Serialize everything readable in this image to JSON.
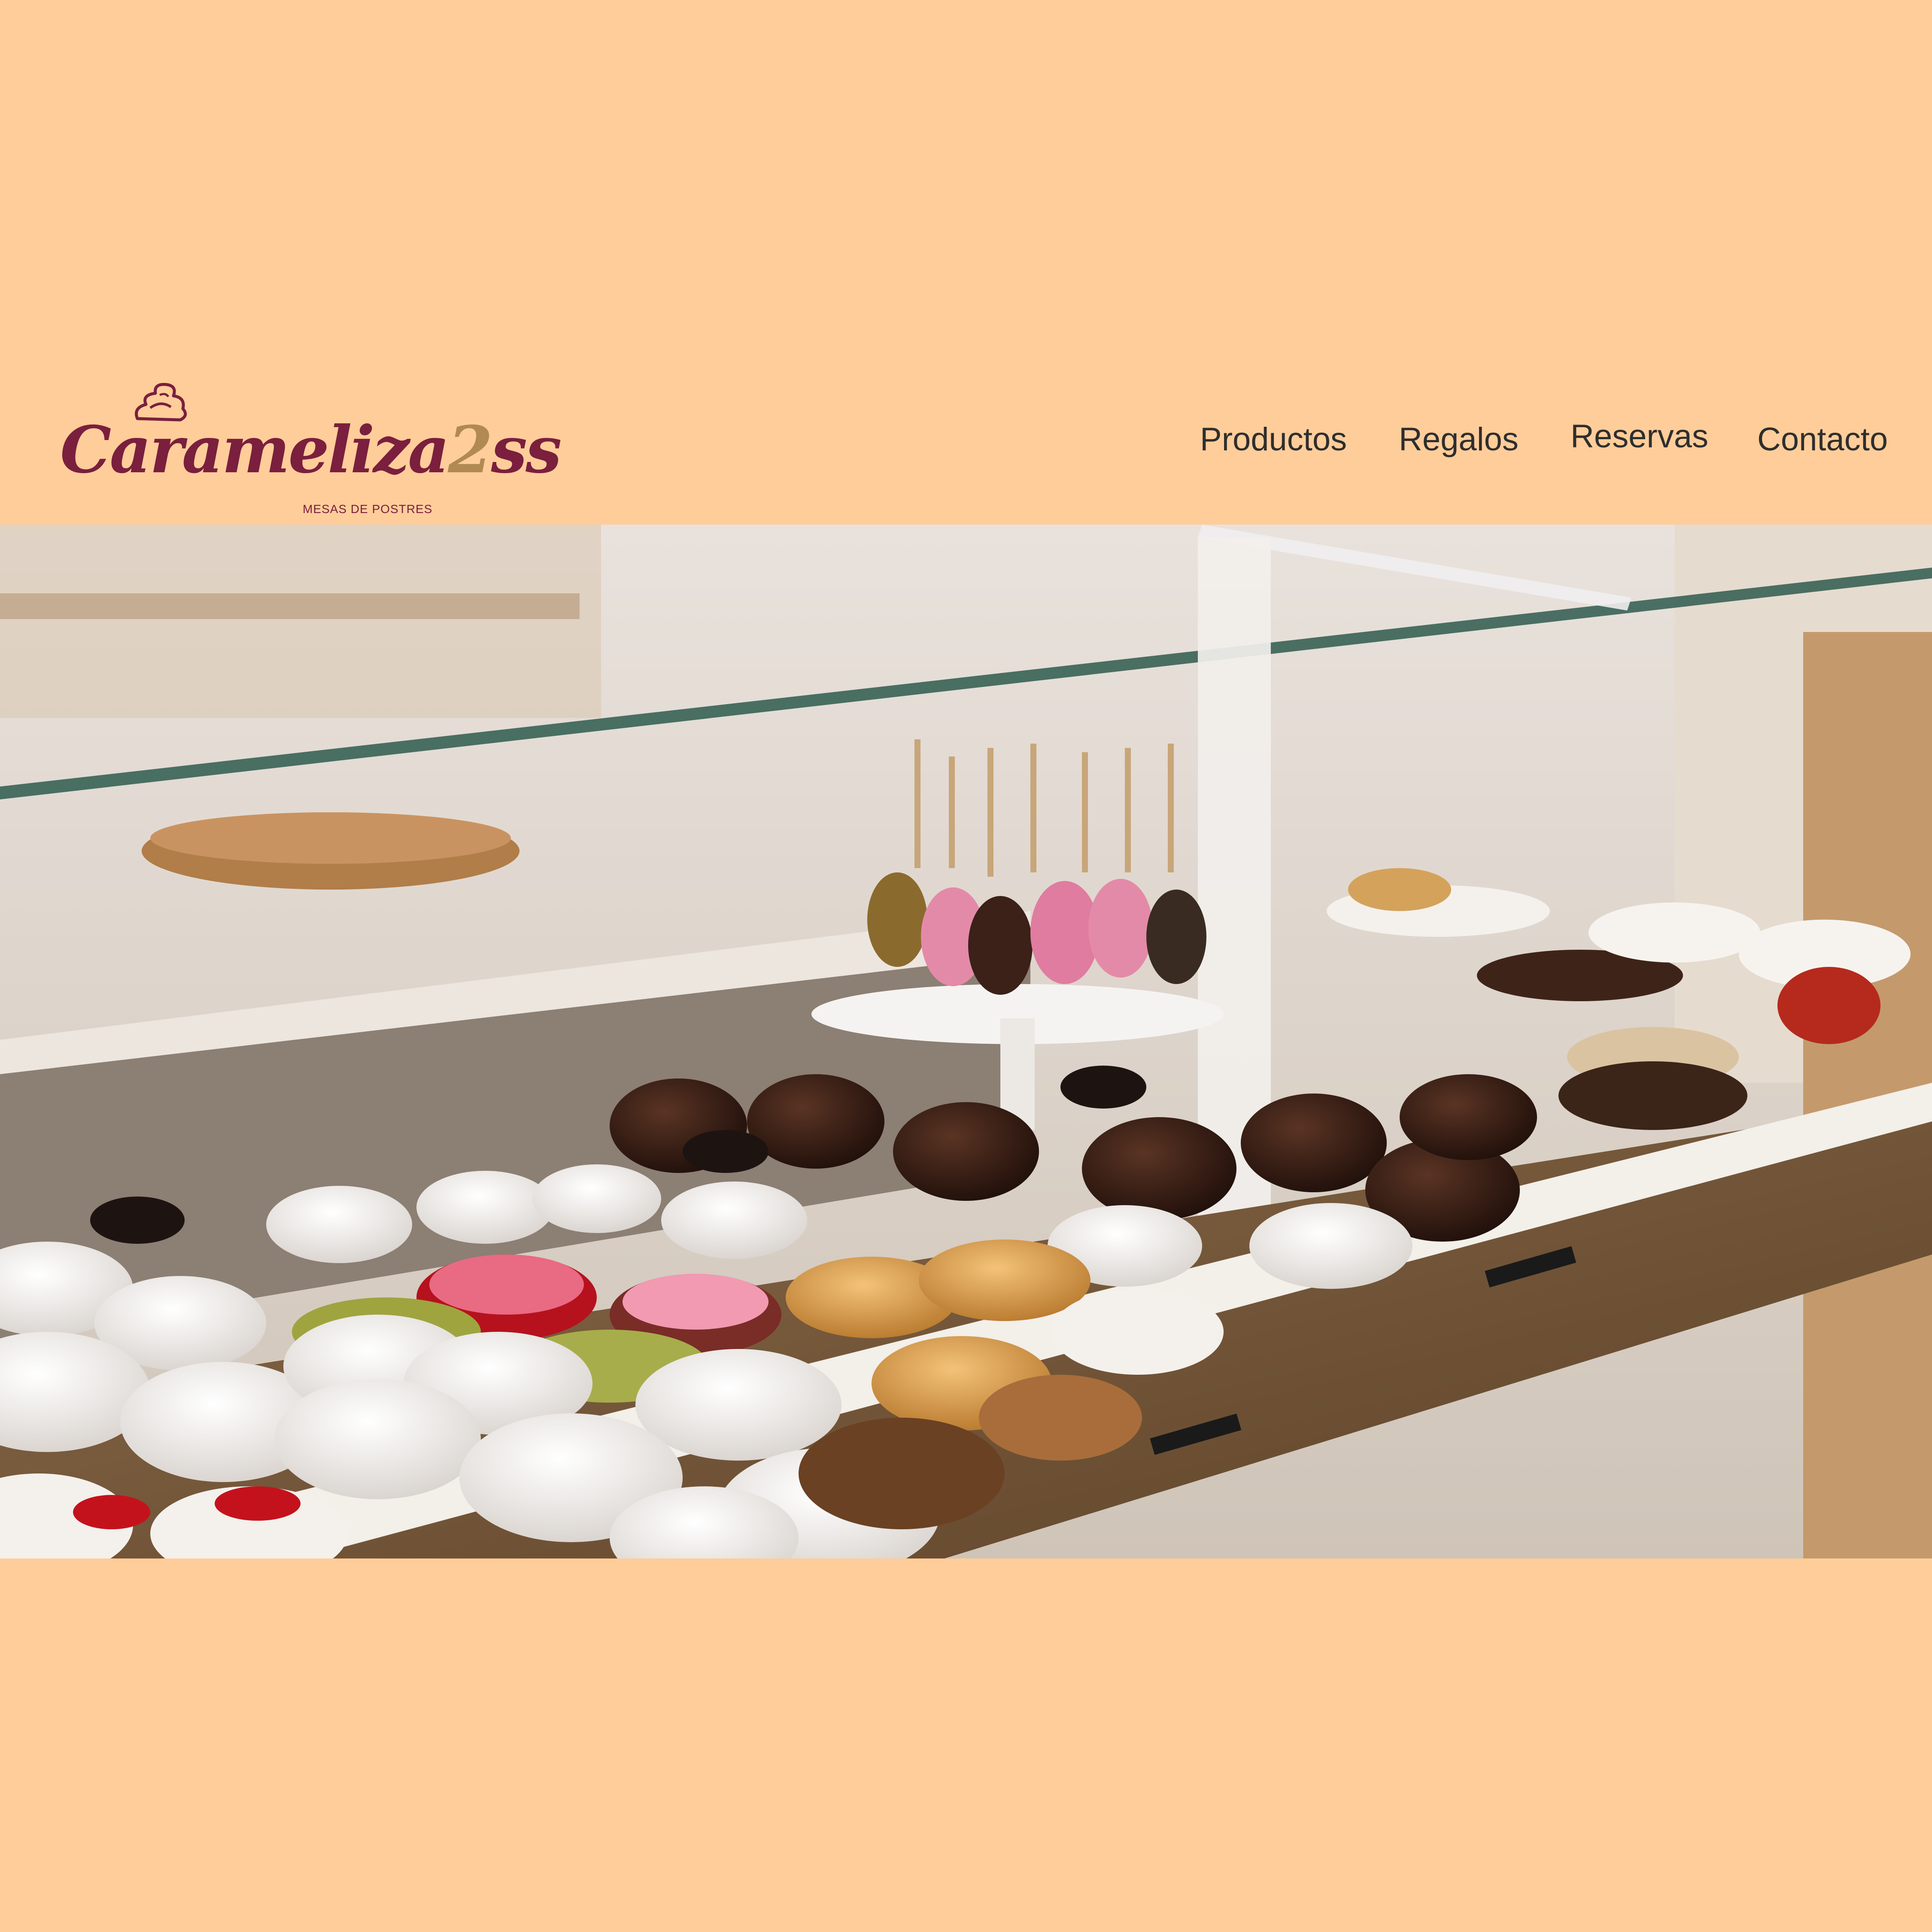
{
  "brand": {
    "name_main": "Carameliza",
    "name_accent": "2",
    "name_tail": "ss",
    "tagline": "MESAS DE POSTRES",
    "icon": "cupcake-swirl-icon",
    "color": "#7a1f3d"
  },
  "nav": {
    "items": [
      {
        "label": "Productos"
      },
      {
        "label": "Regalos"
      },
      {
        "label": "Reservas"
      },
      {
        "label": "Contacto"
      }
    ]
  },
  "hero": {
    "image": "bakery-display-case-donuts-photo"
  },
  "colors": {
    "background": "#ffcd9a",
    "nav_text": "#2e2e2e"
  }
}
